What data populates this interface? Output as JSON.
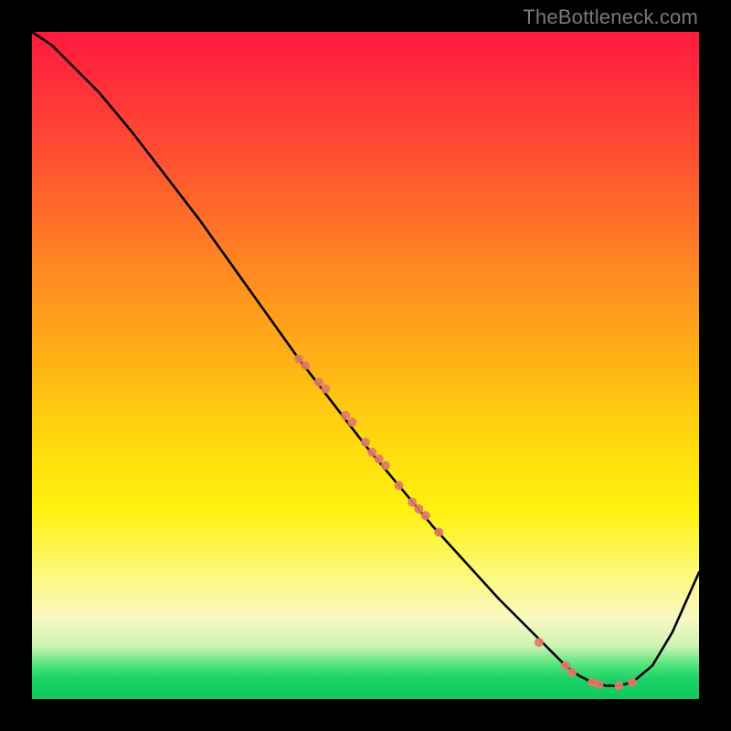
{
  "watermark": "TheBottleneck.com",
  "chart_data": {
    "type": "line",
    "title": "",
    "xlabel": "",
    "ylabel": "",
    "xlim": [
      0,
      100
    ],
    "ylim": [
      0,
      100
    ],
    "grid": false,
    "legend": false,
    "background_gradient": {
      "top": "#ff1a3e",
      "mid_upper": "#ffb415",
      "mid_lower": "#fff210",
      "bottom": "#0fc95f"
    },
    "series": [
      {
        "name": "bottleneck-curve",
        "color": "#000000",
        "x": [
          0,
          3,
          6,
          10,
          15,
          20,
          25,
          30,
          35,
          40,
          45,
          50,
          55,
          60,
          65,
          70,
          75,
          78,
          80,
          82,
          84,
          86,
          88,
          90,
          93,
          96,
          100
        ],
        "y": [
          100,
          98,
          95,
          91,
          85,
          78.5,
          72,
          65,
          58,
          51,
          44.5,
          38,
          32,
          26,
          20.5,
          15,
          10,
          7,
          5,
          3.5,
          2.5,
          2,
          2,
          2.5,
          5,
          10,
          19
        ]
      }
    ],
    "markers": [
      {
        "name": "data-points",
        "color": "#e07a6a",
        "x": [
          40,
          41,
          43,
          44,
          47,
          48,
          50,
          51,
          52,
          53,
          55,
          57,
          58,
          59,
          61,
          76,
          80,
          81,
          84,
          85,
          88,
          90
        ],
        "y": [
          51,
          50,
          47.5,
          46.5,
          42.5,
          41.5,
          38.5,
          37,
          36,
          35,
          32,
          29.5,
          28.5,
          27.5,
          25,
          8.5,
          5,
          4,
          2.5,
          2.2,
          2,
          2.5
        ],
        "size": 10
      }
    ]
  }
}
